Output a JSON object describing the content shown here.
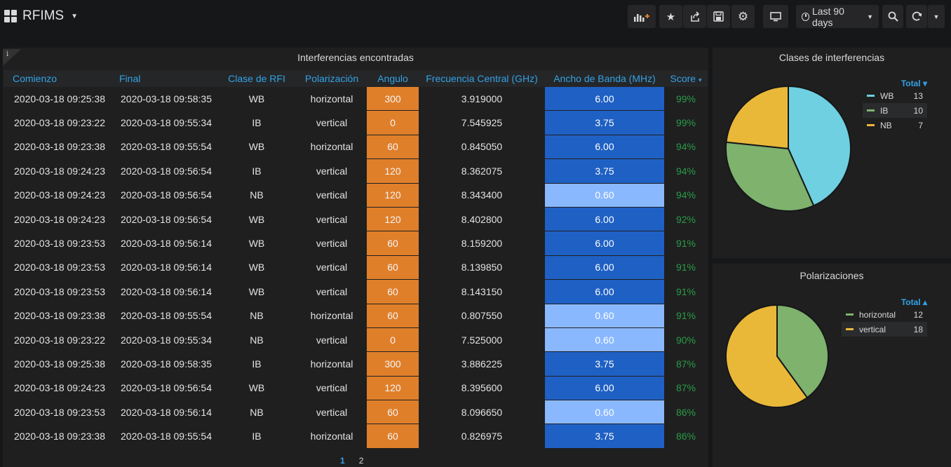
{
  "app": {
    "title": "RFIMS",
    "time_range": "Last 90 days"
  },
  "toolbar": {
    "icons": [
      "add-panel-icon",
      "star-icon",
      "share-icon",
      "save-icon",
      "settings-icon",
      "tv-mode-icon",
      "clock-icon",
      "zoom-out-icon",
      "refresh-icon",
      "refresh-dropdown-icon"
    ]
  },
  "table_panel": {
    "title": "Interferencias encontradas",
    "info_glyph": "i",
    "columns": [
      "Comienzo",
      "Final",
      "Clase de RFI",
      "Polarización",
      "Angulo",
      "Frecuencia Central (GHz)",
      "Ancho de Banda (MHz)",
      "Score"
    ],
    "sort_indicator": "▾",
    "rows": [
      [
        "2020-03-18 09:25:38",
        "2020-03-18 09:58:35",
        "WB",
        "horizontal",
        "300",
        "3.919000",
        "6.00",
        "99%"
      ],
      [
        "2020-03-18 09:23:22",
        "2020-03-18 09:55:34",
        "IB",
        "vertical",
        "0",
        "7.545925",
        "3.75",
        "99%"
      ],
      [
        "2020-03-18 09:23:38",
        "2020-03-18 09:55:54",
        "WB",
        "horizontal",
        "60",
        "0.845050",
        "6.00",
        "94%"
      ],
      [
        "2020-03-18 09:24:23",
        "2020-03-18 09:56:54",
        "IB",
        "vertical",
        "120",
        "8.362075",
        "3.75",
        "94%"
      ],
      [
        "2020-03-18 09:24:23",
        "2020-03-18 09:56:54",
        "NB",
        "vertical",
        "120",
        "8.343400",
        "0.60",
        "94%"
      ],
      [
        "2020-03-18 09:24:23",
        "2020-03-18 09:56:54",
        "WB",
        "vertical",
        "120",
        "8.402800",
        "6.00",
        "92%"
      ],
      [
        "2020-03-18 09:23:53",
        "2020-03-18 09:56:14",
        "WB",
        "vertical",
        "60",
        "8.159200",
        "6.00",
        "91%"
      ],
      [
        "2020-03-18 09:23:53",
        "2020-03-18 09:56:14",
        "WB",
        "vertical",
        "60",
        "8.139850",
        "6.00",
        "91%"
      ],
      [
        "2020-03-18 09:23:53",
        "2020-03-18 09:56:14",
        "WB",
        "vertical",
        "60",
        "8.143150",
        "6.00",
        "91%"
      ],
      [
        "2020-03-18 09:23:38",
        "2020-03-18 09:55:54",
        "NB",
        "horizontal",
        "60",
        "0.807550",
        "0.60",
        "91%"
      ],
      [
        "2020-03-18 09:23:22",
        "2020-03-18 09:55:34",
        "NB",
        "vertical",
        "0",
        "7.525000",
        "0.60",
        "90%"
      ],
      [
        "2020-03-18 09:25:38",
        "2020-03-18 09:58:35",
        "IB",
        "horizontal",
        "300",
        "3.886225",
        "3.75",
        "87%"
      ],
      [
        "2020-03-18 09:24:23",
        "2020-03-18 09:56:54",
        "WB",
        "vertical",
        "120",
        "8.395600",
        "6.00",
        "87%"
      ],
      [
        "2020-03-18 09:23:53",
        "2020-03-18 09:56:14",
        "NB",
        "vertical",
        "60",
        "8.096650",
        "0.60",
        "86%"
      ],
      [
        "2020-03-18 09:23:38",
        "2020-03-18 09:55:54",
        "IB",
        "horizontal",
        "60",
        "0.826975",
        "3.75",
        "86%"
      ]
    ],
    "pages": [
      "1",
      "2"
    ],
    "active_page": "1",
    "colors": {
      "angle": "#e07f2a",
      "bw_high": "#1f60c4",
      "bw_low": "#8ab8ff",
      "score": "#299c46",
      "header": "#33a2e5"
    }
  },
  "chart_data": [
    {
      "type": "pie",
      "title": "Clases de interferencias",
      "legend_header": "Total ▾",
      "series": [
        {
          "name": "WB",
          "value": 13,
          "color": "#6ed0e0"
        },
        {
          "name": "IB",
          "value": 10,
          "color": "#7eb26d"
        },
        {
          "name": "NB",
          "value": 7,
          "color": "#eab839"
        }
      ],
      "legend_position": "right"
    },
    {
      "type": "pie",
      "title": "Polarizaciones",
      "legend_header": "Total ▴",
      "series": [
        {
          "name": "horizontal",
          "value": 12,
          "color": "#7eb26d"
        },
        {
          "name": "vertical",
          "value": 18,
          "color": "#eab839"
        }
      ],
      "legend_position": "right"
    }
  ]
}
